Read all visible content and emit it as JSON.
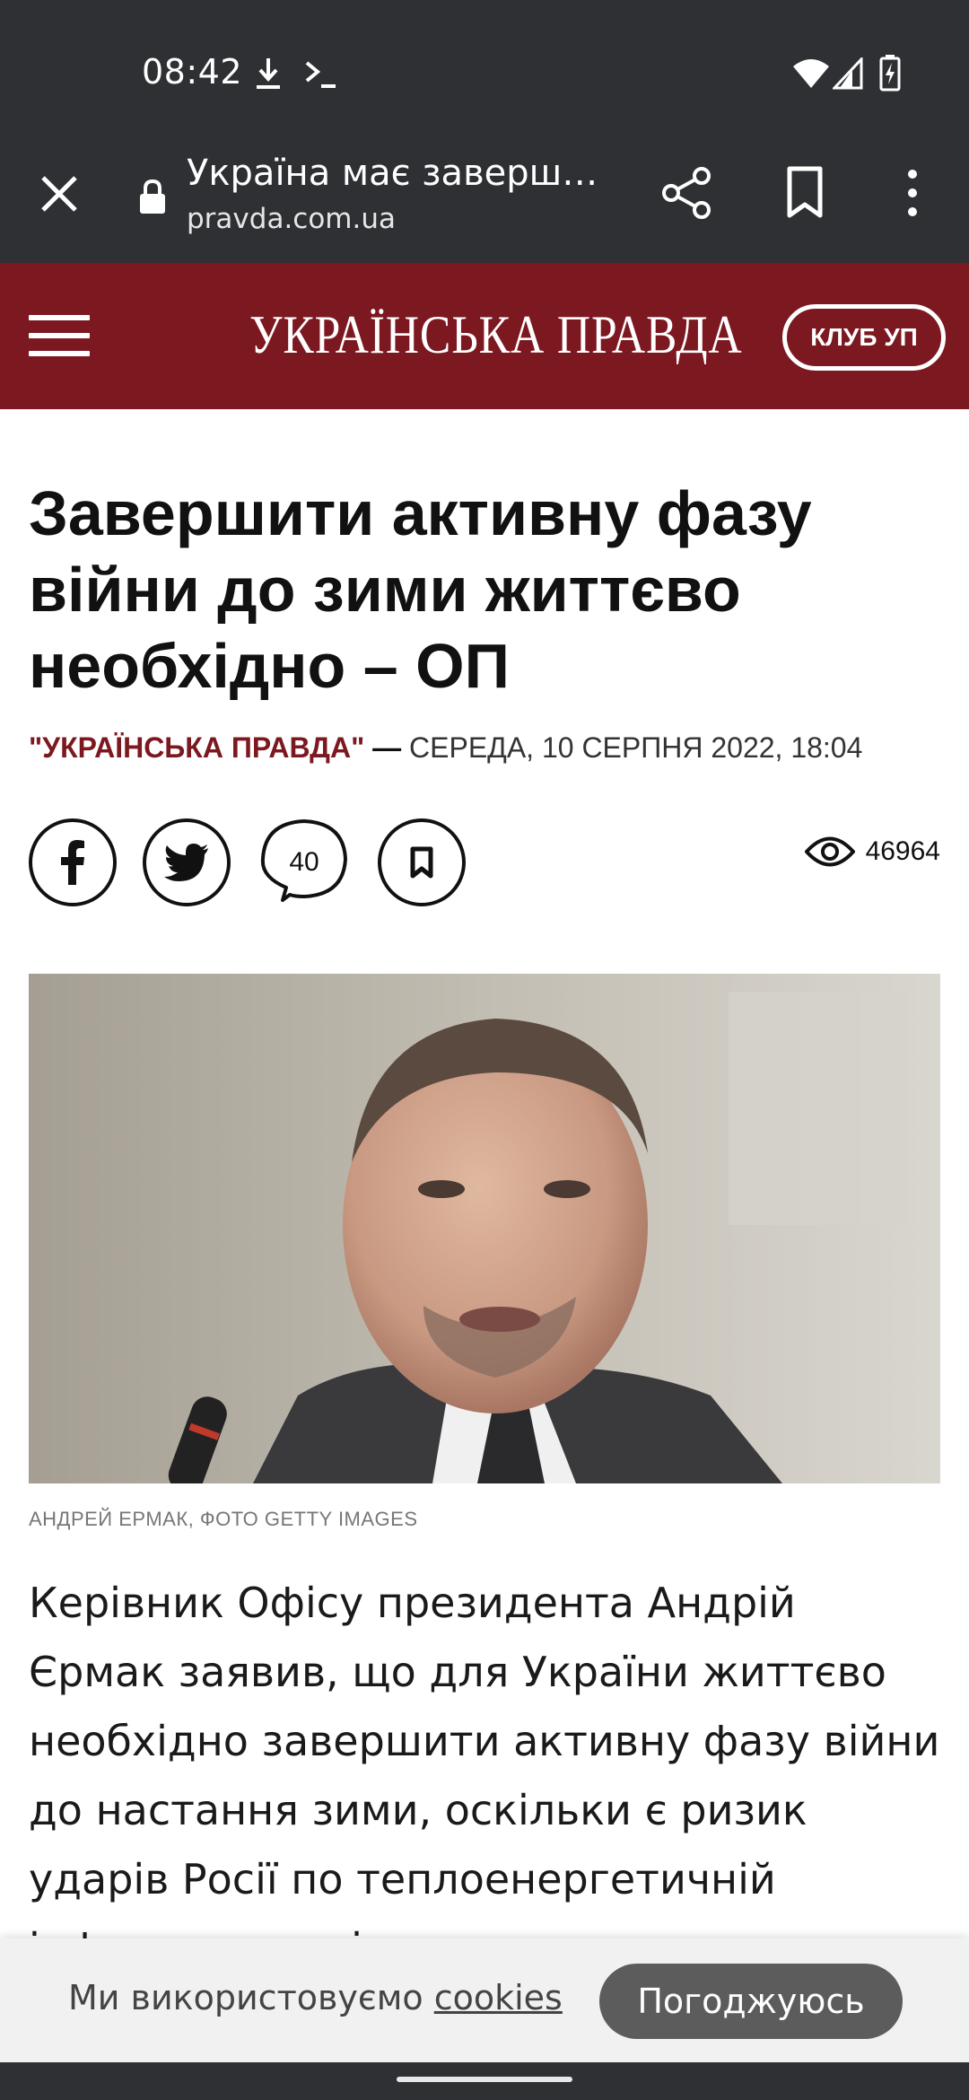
{
  "status_bar": {
    "time": "08:42",
    "icons": [
      "download-icon",
      "terminal-icon",
      "wifi-icon",
      "signal-icon",
      "battery-charging-icon"
    ]
  },
  "browser": {
    "page_title": "Україна має заверш…",
    "url": "pravda.com.ua",
    "icons": [
      "close-icon",
      "lock-icon",
      "share-icon",
      "bookmark-icon",
      "more-vert-icon"
    ]
  },
  "site_header": {
    "logo": "УКРАЇНСЬКА ПРАВДА",
    "club_button": "КЛУБ УП",
    "colors": {
      "brand": "#7c1820"
    }
  },
  "article": {
    "headline": "Завершити активну фазу війни до зими життєво необхідно – ОП",
    "source": "\"УКРАЇНСЬКА ПРАВДА\"",
    "separator": "—",
    "date": "СЕРЕДА, 10 СЕРПНЯ 2022, 18:04",
    "comments_count": "40",
    "views_count": "46964",
    "photo_caption": "АНДРЕЙ ЕРМАК, ФОТО GETTY IMAGES",
    "body": "Керівник Офісу президента Андрій Єрмак заявив, що для України життєво необхідно завершити активну фазу війни до настання зими, оскільки є ризик ударів Росії по теплоенергетичній інфраструктурі"
  },
  "cookie_banner": {
    "text": "Ми використовуємо",
    "link": "cookies",
    "accept_button": "Погоджуюсь"
  }
}
